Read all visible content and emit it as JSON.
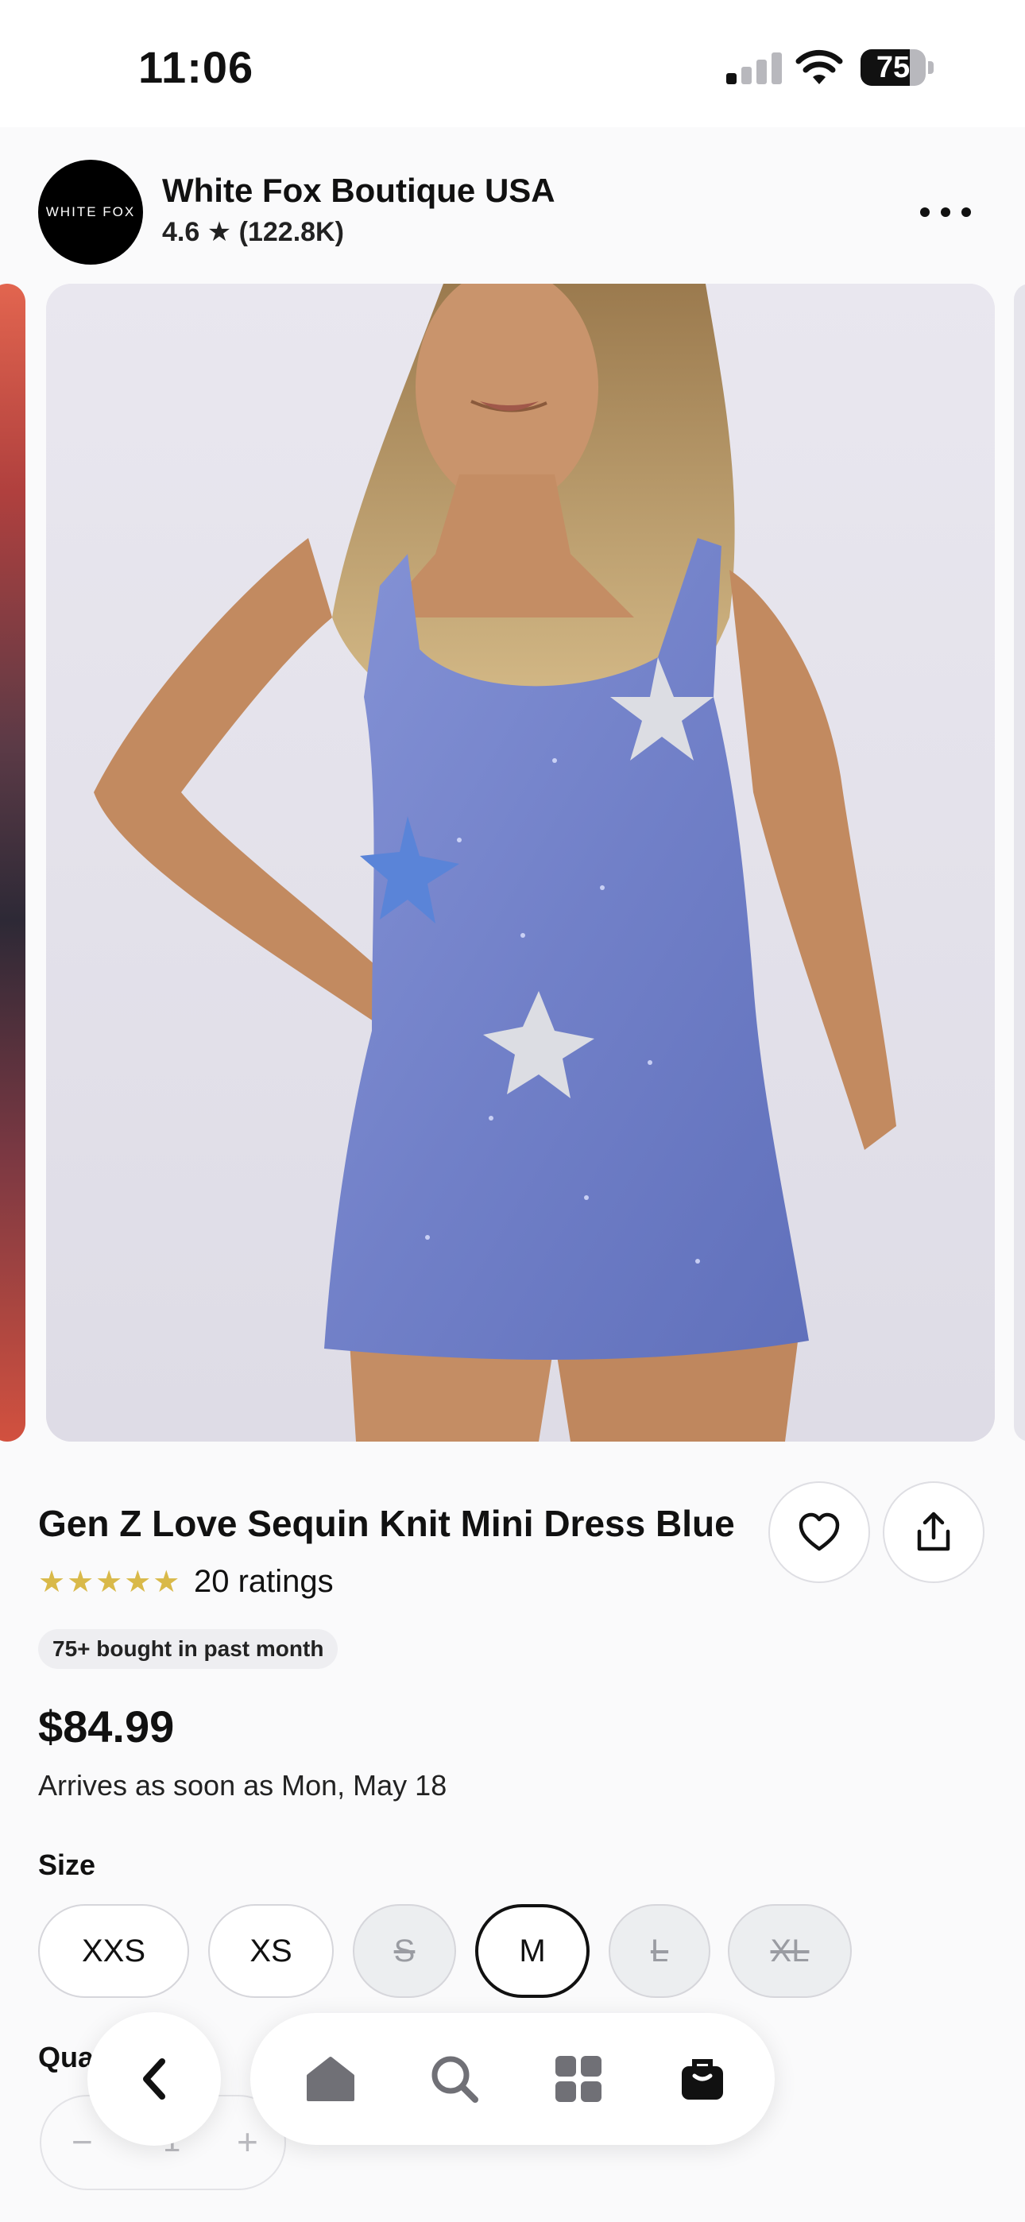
{
  "status_bar": {
    "time": "11:06",
    "battery": "75",
    "battery_level": 0.75
  },
  "shop": {
    "logo_text": "WHITE FOX",
    "name": "White Fox Boutique USA",
    "rating": "4.6 ★ (122.8K)"
  },
  "product": {
    "title": "Gen Z Love Sequin Knit Mini Dress Blue",
    "stars": "★★★★★",
    "ratings": "20 ratings",
    "badge": "75+ bought in past month",
    "price": "$84.99",
    "arrival": "Arrives as soon as Mon, May 18"
  },
  "size": {
    "label": "Size",
    "options": [
      "XXS",
      "XS",
      "S",
      "M",
      "L",
      "XL"
    ],
    "selected": "M",
    "unavailable": [
      "S",
      "L",
      "XL"
    ]
  },
  "quantity": {
    "label": "Qua",
    "minus": "−",
    "value": "1",
    "plus": "+"
  },
  "colors": {
    "dress": "#7d8bd0",
    "badge_bg": "#eeeef1",
    "star": "#d9b949"
  },
  "nav": {
    "icons": [
      "back-icon",
      "home-icon",
      "search-icon",
      "grid-icon",
      "bag-icon"
    ]
  }
}
